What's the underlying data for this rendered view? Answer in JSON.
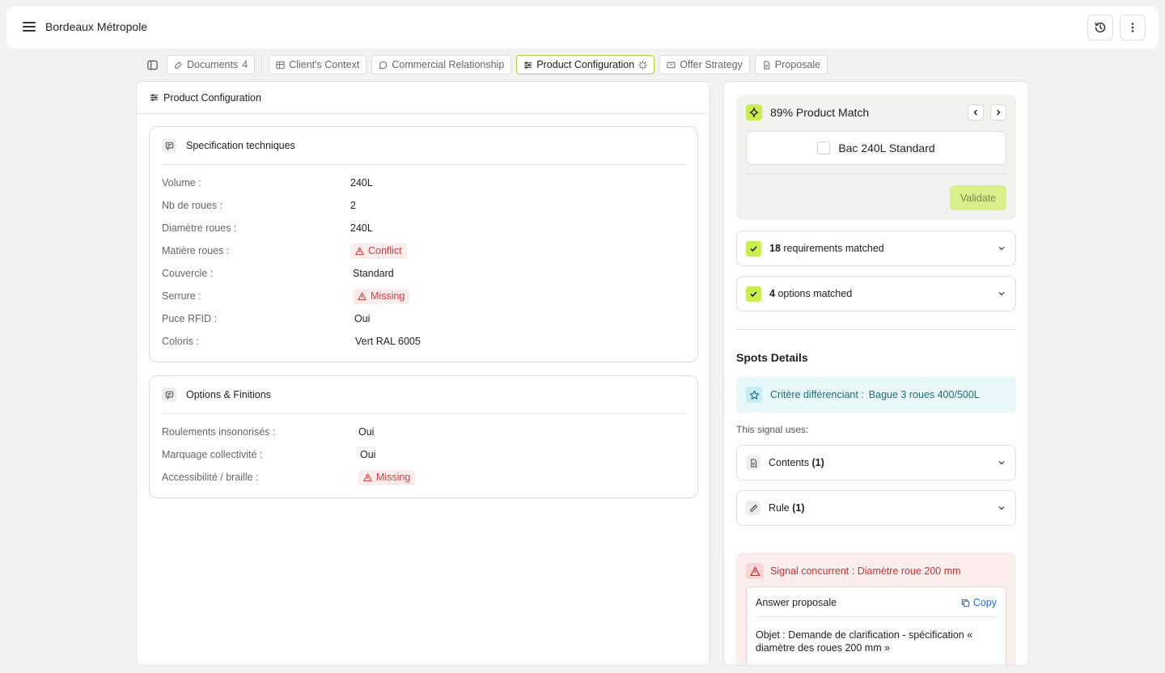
{
  "header": {
    "title": "Bordeaux Métropole"
  },
  "tabs": [
    {
      "label": "Documents",
      "count": "4"
    },
    {
      "label": "Client's Context"
    },
    {
      "label": "Commercial Relationship"
    },
    {
      "label": "Product Configuration"
    },
    {
      "label": "Offer Strategy"
    },
    {
      "label": "Proposale"
    }
  ],
  "left_panel": {
    "title": "Product Configuration",
    "spec_card": {
      "title": "Specification techniques",
      "rows": [
        {
          "label": "Volume :",
          "value": "240L"
        },
        {
          "label": "Nb de roues :",
          "value": "2"
        },
        {
          "label": "Diamètre roues :",
          "value": "240L"
        },
        {
          "label": "Matière roues :",
          "badge": "Conflict"
        },
        {
          "label": "Couvercle :",
          "value": "Standard"
        },
        {
          "label": "Serrure :",
          "badge": "Missing"
        },
        {
          "label": "Puce RFID :",
          "value": "Oui"
        },
        {
          "label": "Coloris :",
          "value": "Vert RAL 6005"
        }
      ]
    },
    "options_card": {
      "title": "Options & Finitions",
      "rows": [
        {
          "label": "Roulements insonorisés :",
          "value": "Oui"
        },
        {
          "label": "Marquage collectivité :",
          "value": "Oui"
        },
        {
          "label": "Accessibilité / braille :",
          "badge": "Missing"
        }
      ]
    }
  },
  "right_panel": {
    "match": {
      "title": "89% Product Match",
      "product": "Bac 240L Standard",
      "validate": "Validate"
    },
    "requirements": {
      "count": "18",
      "label": "requirements matched"
    },
    "options": {
      "count": "4",
      "label": "options matched"
    },
    "spots_title": "Spots Details",
    "criterion": {
      "label": "Critère différenciant :",
      "value": "Bague 3 roues 400/500L"
    },
    "signal_uses": "This signal uses:",
    "contents": {
      "label": "Contents",
      "count": "(1)"
    },
    "rule": {
      "label": "Rule",
      "count": "(1)"
    },
    "concurrent": {
      "title": "Signal concurrent : Diamètre roue 200 mm",
      "answer_title": "Answer proposale",
      "copy": "Copy",
      "body": "Objet : Demande de clarification - spécification « diamètre des roues 200 mm »"
    }
  },
  "colors": {
    "accent": "#c9ee4f",
    "danger": "#d33b3b",
    "info": "#1f6e78",
    "link": "#2a6fdb"
  }
}
